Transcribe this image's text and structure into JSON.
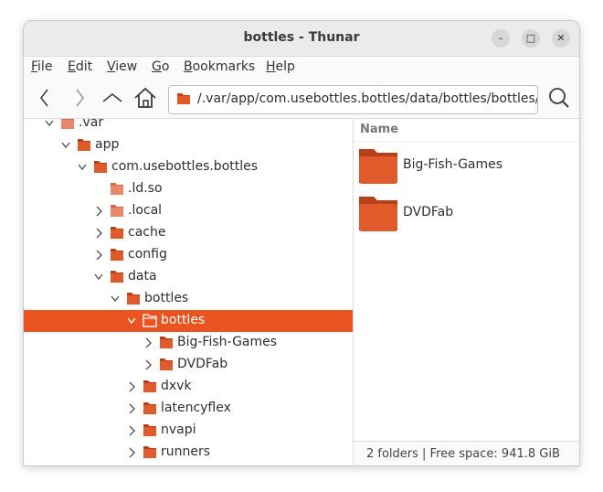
{
  "window": {
    "title": "bottles - Thunar"
  },
  "window_controls": {
    "minimize": "–",
    "maximize": "□",
    "close": "✕"
  },
  "menubar": {
    "items": [
      {
        "accel": "F",
        "rest": "ile"
      },
      {
        "accel": "E",
        "rest": "dit"
      },
      {
        "accel": "V",
        "rest": "iew"
      },
      {
        "accel": "G",
        "rest": "o"
      },
      {
        "accel": "B",
        "rest": "ookmarks"
      },
      {
        "accel": "H",
        "rest": "elp"
      }
    ]
  },
  "toolbar": {
    "back_icon": "chevron-left-icon",
    "forward_icon": "chevron-right-icon",
    "up_icon": "chevron-up-icon",
    "home_icon": "home-icon",
    "search_icon": "search-icon",
    "location": "/.var/app/com.usebottles.bottles/data/bottles/bottles/"
  },
  "tree": {
    "items": [
      {
        "label": ".var",
        "expander": "down",
        "light": true
      },
      {
        "label": "app",
        "expander": "down",
        "light": false
      },
      {
        "label": "com.usebottles.bottles",
        "expander": "down",
        "light": false
      },
      {
        "label": ".ld.so",
        "expander": "none",
        "light": true
      },
      {
        "label": ".local",
        "expander": "right",
        "light": true
      },
      {
        "label": "cache",
        "expander": "right",
        "light": false
      },
      {
        "label": "config",
        "expander": "right",
        "light": false
      },
      {
        "label": "data",
        "expander": "down",
        "light": false
      },
      {
        "label": "bottles",
        "expander": "down",
        "light": false
      },
      {
        "label": "bottles",
        "expander": "down",
        "light": false,
        "selected": true
      },
      {
        "label": "Big-Fish-Games",
        "expander": "right",
        "light": false
      },
      {
        "label": "DVDFab",
        "expander": "right",
        "light": false
      },
      {
        "label": "dxvk",
        "expander": "right",
        "light": false
      },
      {
        "label": "latencyflex",
        "expander": "right",
        "light": false
      },
      {
        "label": "nvapi",
        "expander": "right",
        "light": false
      },
      {
        "label": "runners",
        "expander": "right",
        "light": false
      }
    ]
  },
  "list": {
    "column_name": "Name",
    "items": [
      {
        "label": "Big-Fish-Games"
      },
      {
        "label": "DVDFab"
      }
    ]
  },
  "status": {
    "text": "2 folders  |  Free space: 941.8 GiB"
  },
  "colors": {
    "accent": "#e95420",
    "folder": "#e05a2b",
    "folder_light": "#e8876a"
  }
}
